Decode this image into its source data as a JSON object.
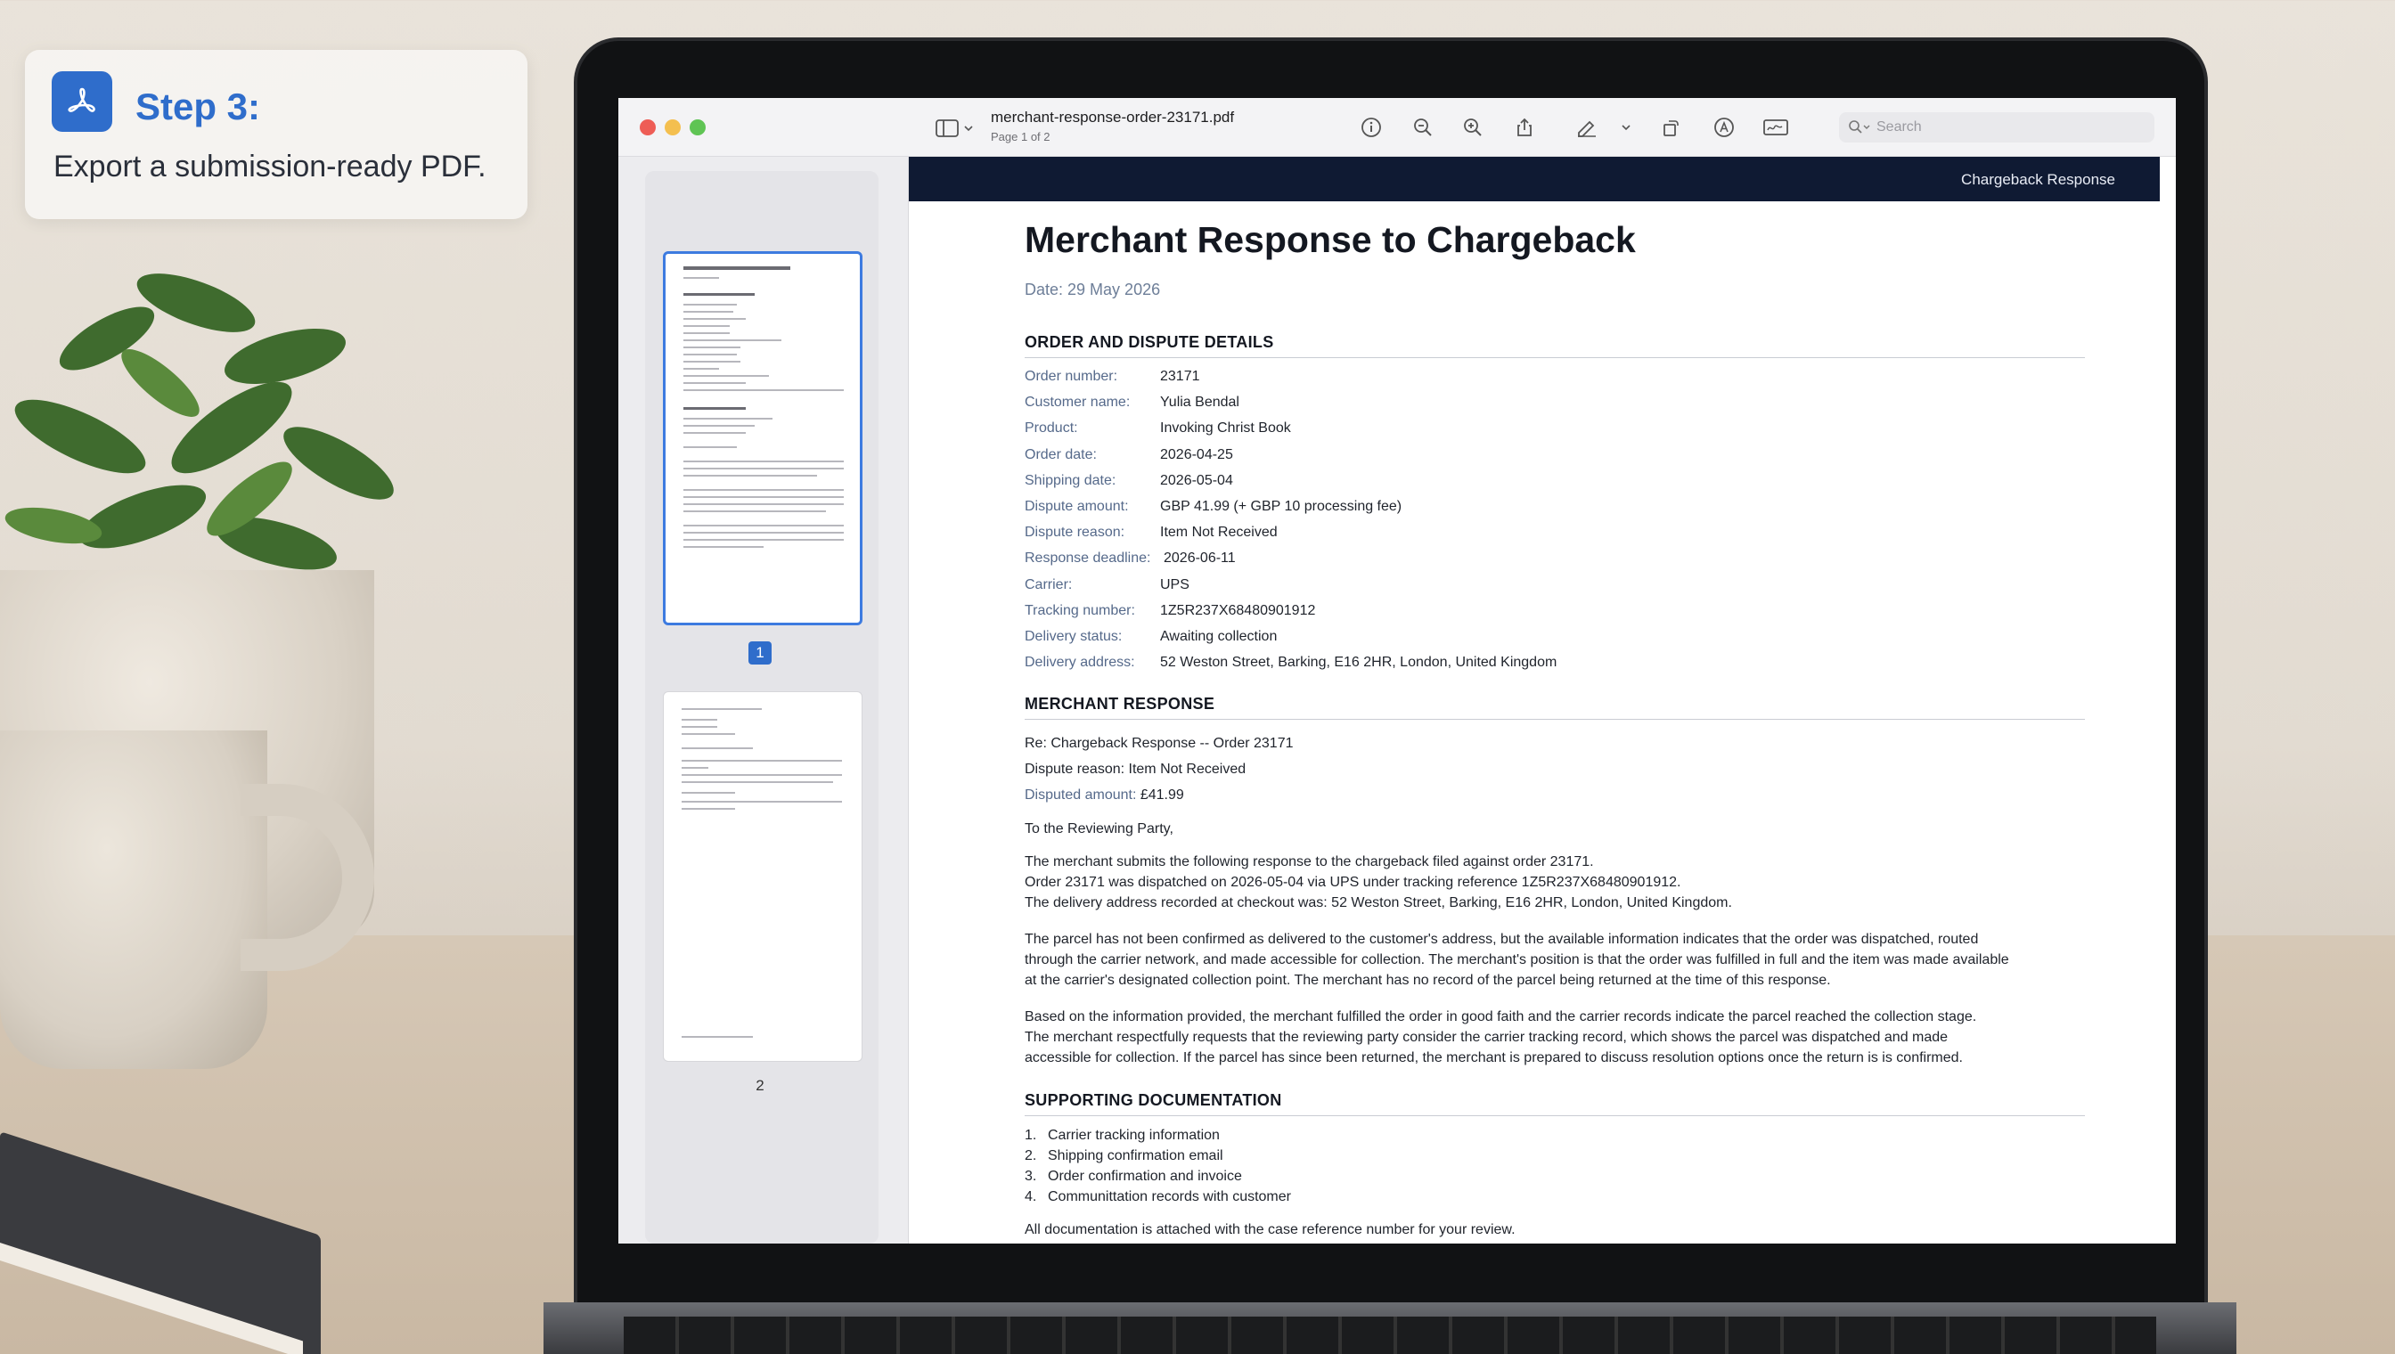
{
  "step": {
    "title": "Step 3:",
    "subtitle": "Export a submission-ready PDF.",
    "icon": "acrobat-icon"
  },
  "window": {
    "file_name": "merchant-response-order-23171.pdf",
    "page_info": "Page 1 of 2",
    "search_placeholder": "Search"
  },
  "toolbar": {
    "icons": [
      "info-icon",
      "zoom-out-icon",
      "zoom-in-icon",
      "share-icon",
      "markup-pen-icon",
      "chevron-down-icon",
      "rotate-icon",
      "annotate-icon",
      "signature-icon"
    ]
  },
  "sidebar": {
    "pages": [
      "1",
      "2"
    ]
  },
  "document": {
    "header_bar": "Chargeback Response",
    "title": "Merchant Response to Chargeback",
    "date": "Date: 29 May 2026",
    "section1_title": "ORDER AND DISPUTE DETAILS",
    "details": [
      {
        "label": "Order number:",
        "value": "23171"
      },
      {
        "label": "Customer name:",
        "value": "Yulia Bendal"
      },
      {
        "label": "Product:",
        "value": "Invoking Christ Book"
      },
      {
        "label": "Order date:",
        "value": "2026-04-25"
      },
      {
        "label": "Shipping date:",
        "value": "2026-05-04"
      },
      {
        "label": "Dispute amount:",
        "value": "GBP 41.99 (+ GBP 10 processing fee)"
      },
      {
        "label": "Dispute reason:",
        "value": "Item Not Received"
      },
      {
        "label": "Response deadline:",
        "value": "2026-06-11"
      },
      {
        "label": "Carrier:",
        "value": "UPS"
      },
      {
        "label": "Tracking number:",
        "value": "1Z5R237X68480901912"
      },
      {
        "label": "Delivery status:",
        "value": "Awaiting collection"
      },
      {
        "label": "Delivery address:",
        "value": "52 Weston Street, Barking, E16 2HR, London, United Kingdom"
      }
    ],
    "section2_title": "MERCHANT RESPONSE",
    "re_line": "Re: Chargeback Response -- Order 23171",
    "resp_reason_label": "Dispute reason:",
    "resp_reason_value": "Item Not Received",
    "resp_amount_label": "Disputed amount:",
    "resp_amount_value": "£41.99",
    "salutation": "To the Reviewing Party,",
    "para1_l1": "The merchant submits the following response to the chargeback filed against order 23171.",
    "para1_l2": "Order 23171 was dispatched on 2026-05-04 via UPS under tracking reference 1Z5R237X68480901912.",
    "para1_l3": "The delivery address recorded at checkout was: 52 Weston Street, Barking, E16 2HR, London, United Kingdom.",
    "para2_l1": "The parcel has not been confirmed as delivered to the customer's address, but the available information indicates that the order was dispatched, routed",
    "para2_l2": "through the carrier network, and made accessible for collection. The merchant's position is that the order was fulfilled in full and the item was made available",
    "para2_l3": "at the carrier's designated collection point. The merchant has no record of the parcel being returned at the time of this response.",
    "para3_l1": "Based on the information provided, the merchant fulfilled the order in good faith and the carrier records indicate the parcel reached the collection stage.",
    "para3_l2": "The merchant respectfully requests that the reviewing party consider the carrier tracking record, which shows the parcel was dispatched and made",
    "para3_l3": "accessible for collection. If the parcel has since been returned, the merchant is prepared to discuss resolution options once the return is is confirmed.",
    "section3_title": "SUPPORTING DOCUMENTATION",
    "docs": [
      {
        "num": "1.",
        "text": "Carrier tracking information"
      },
      {
        "num": "2.",
        "text": "Shipping confirmation email"
      },
      {
        "num": "3.",
        "text": "Order confirmation and invoice"
      },
      {
        "num": "4.",
        "text": "Communittation records with customer"
      }
    ],
    "closing": "All documentation is attached with the case reference number for your review."
  },
  "colors": {
    "accent": "#2f6dcb",
    "header_bar": "#0f1a33",
    "label": "#55698a"
  }
}
